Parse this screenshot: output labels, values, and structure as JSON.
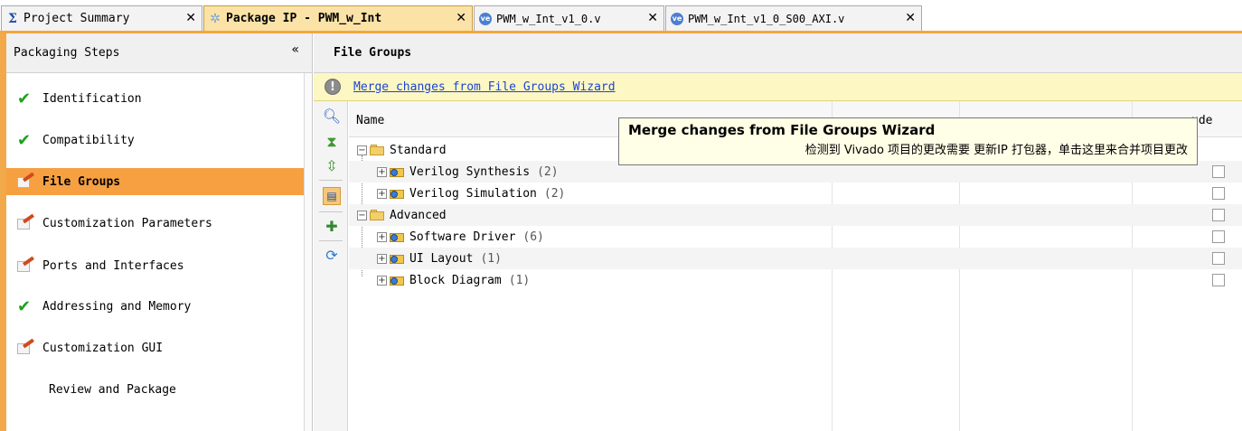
{
  "tabs": [
    {
      "label": "Project Summary",
      "icon": "sigma-icon",
      "active": false
    },
    {
      "label": "Package IP - PWM_w_Int",
      "icon": "package-icon",
      "active": true
    },
    {
      "label": "PWM_w_Int_v1_0.v",
      "icon": "verilog-file-icon",
      "active": false
    },
    {
      "label": "PWM_w_Int_v1_0_S00_AXI.v",
      "icon": "verilog-file-icon",
      "active": false
    }
  ],
  "left_panel": {
    "title": "Packaging Steps",
    "collapse_glyph": "«",
    "steps": [
      {
        "label": "Identification",
        "status": "check"
      },
      {
        "label": "Compatibility",
        "status": "check"
      },
      {
        "label": "File Groups",
        "status": "edit",
        "active": true
      },
      {
        "label": "Customization Parameters",
        "status": "edit"
      },
      {
        "label": "Ports and Interfaces",
        "status": "edit"
      },
      {
        "label": "Addressing and Memory",
        "status": "check"
      },
      {
        "label": "Customization GUI",
        "status": "edit"
      },
      {
        "label": "Review and Package",
        "status": "none"
      }
    ]
  },
  "right_panel": {
    "title": "File Groups",
    "info_link": "Merge changes from File Groups Wizard",
    "columns": {
      "name": "Name",
      "include": "ude"
    },
    "tree": [
      {
        "label": "Standard",
        "type": "folder",
        "level": 0,
        "count": ""
      },
      {
        "label": "Verilog Synthesis",
        "type": "group",
        "level": 1,
        "count": "(2)"
      },
      {
        "label": "Verilog Simulation",
        "type": "group",
        "level": 1,
        "count": "(2)"
      },
      {
        "label": "Advanced",
        "type": "folder",
        "level": 0,
        "count": ""
      },
      {
        "label": "Software Driver",
        "type": "group",
        "level": 1,
        "count": "(6)"
      },
      {
        "label": "UI Layout",
        "type": "group",
        "level": 1,
        "count": "(1)"
      },
      {
        "label": "Block Diagram",
        "type": "group",
        "level": 1,
        "count": "(1)"
      }
    ]
  },
  "tooltip": {
    "title": "Merge changes from File Groups Wizard",
    "body": "检测到 Vivado 项目的更改需要 更新IP 打包器，单击这里来合并项目更改"
  },
  "colors": {
    "accent_orange": "#f6a042",
    "check_green": "#1aa31a",
    "link_blue": "#1b44d6",
    "info_yellow": "#fdf7c4"
  }
}
